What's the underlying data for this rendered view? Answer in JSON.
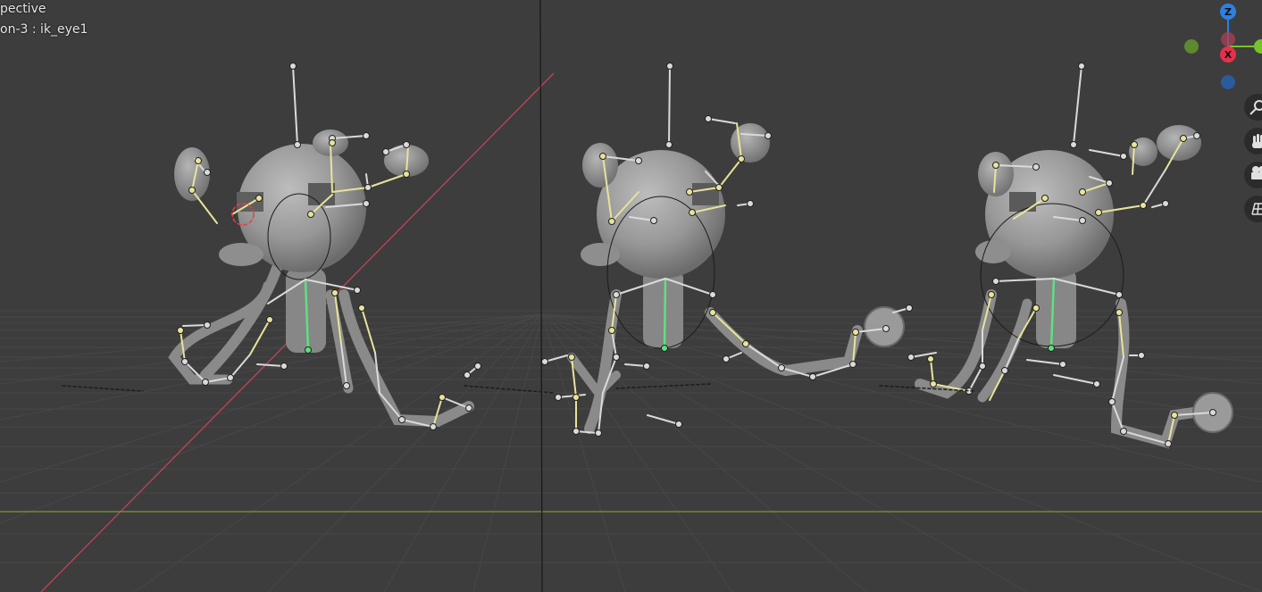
{
  "viewport": {
    "view_label": "pective",
    "object_label": "on-3 : ik_eye1",
    "colors": {
      "background": "#3d3d3d",
      "grid": "#474747",
      "x_axis": "#c24454",
      "y_axis": "#7a9a3a",
      "active_bone": "#5fe07f",
      "selected_bone": "#e8e39a",
      "bone": "#dadada",
      "model": "#9e9e9e"
    }
  },
  "gizmo": {
    "axes": [
      {
        "label": "Z",
        "color": "#2e7fe0"
      },
      {
        "label": "X",
        "color": "#e6304a"
      }
    ],
    "colors": {
      "y": "#74c42a",
      "neg_y": "#5d8a2e",
      "neg_z": "#2c5a9e",
      "neg_x": "#b04050"
    }
  },
  "nav_buttons": [
    {
      "name": "zoom-icon"
    },
    {
      "name": "pan-hand-icon"
    },
    {
      "name": "camera-icon"
    },
    {
      "name": "grid-icon"
    }
  ]
}
